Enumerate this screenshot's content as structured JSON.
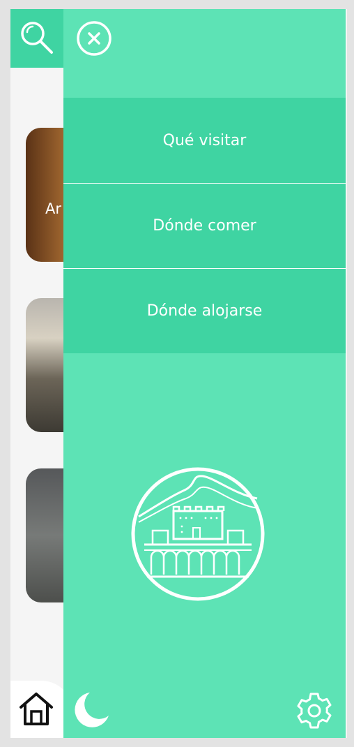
{
  "colors": {
    "drawer_background": "#5de3b5",
    "menu_item_background": "#3fd4a2",
    "text": "#ffffff",
    "page_background": "#f5f5f5"
  },
  "header": {
    "search_icon": "search-icon",
    "close_icon": "close-icon"
  },
  "cards": [
    {
      "label": "Ar"
    },
    {
      "label": ""
    },
    {
      "label": ""
    }
  ],
  "menu": {
    "items": [
      {
        "label": "Qué visitar"
      },
      {
        "label": "Dónde comer"
      },
      {
        "label": "Dónde alojarse"
      }
    ]
  },
  "footer": {
    "home_icon": "home-icon",
    "night_mode_icon": "moon-icon",
    "settings_icon": "gear-icon"
  },
  "emblem": "alhambra-emblem"
}
